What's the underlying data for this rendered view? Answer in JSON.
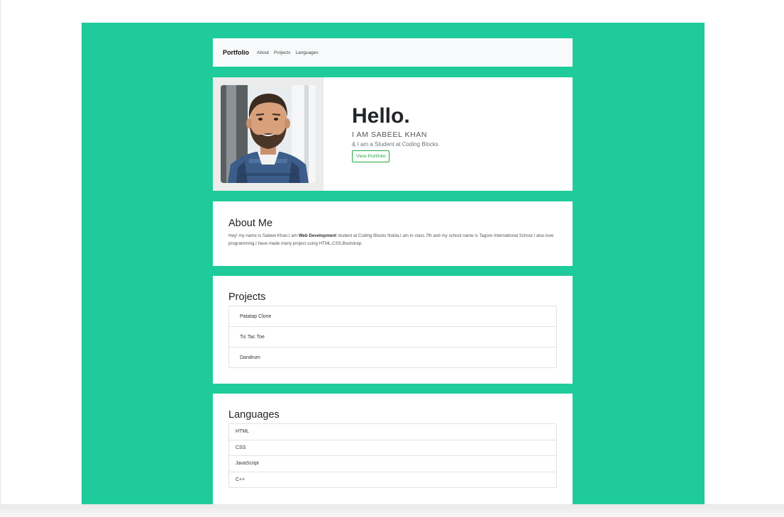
{
  "navbar": {
    "brand": "Portfolio",
    "links": [
      "About",
      "Projects",
      "Languages"
    ]
  },
  "hero": {
    "greeting": "Hello.",
    "name_line": "I AM SABEEL KHAN",
    "subtitle": "& I am a Student at Coding Blocks",
    "button_label": "View Portfolio"
  },
  "about": {
    "title": "About Me",
    "text_before": "Hey! my name is Sabeel Khan.I am ",
    "text_bold": "Web Development",
    "text_after": " student at Coding Blocks Noida.I am in class 7th and my school name is Tagore International School.I also love programming.I have made many project using HTML,CSS,Bootstrap."
  },
  "projects": {
    "title": "Projects",
    "items": [
      "Patatap Clone",
      "Tic Tac Toe",
      "Dandrum"
    ]
  },
  "languages": {
    "title": "Languages",
    "items": [
      "HTML",
      "CSS",
      "JavaScript",
      "C++"
    ]
  },
  "colors": {
    "background": "#1fca9b",
    "accent": "#28a745"
  }
}
